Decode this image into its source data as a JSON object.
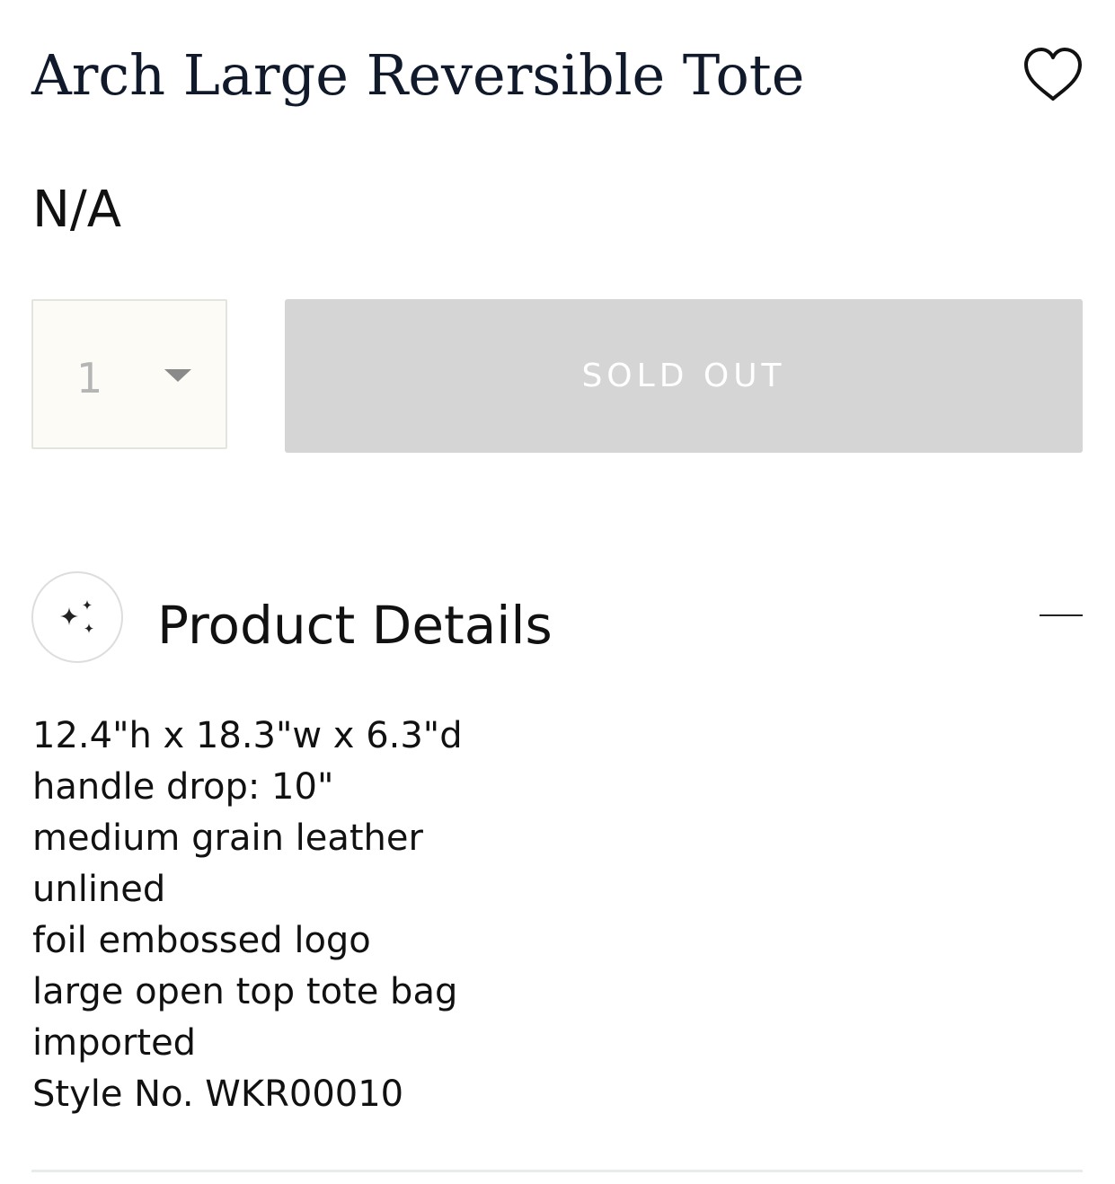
{
  "product": {
    "title": "Arch Large Reversible Tote",
    "price": "N/A"
  },
  "purchase": {
    "quantity": "1",
    "button_label": "SOLD OUT"
  },
  "details": {
    "heading": "Product Details",
    "items": [
      "12.4\"h x 18.3\"w x 6.3\"d",
      "handle drop: 10\"",
      "medium grain leather",
      "unlined",
      "foil embossed logo",
      "large open top tote bag",
      "imported",
      "Style No. WKR00010"
    ]
  },
  "icons": {
    "wishlist": "heart-icon",
    "details": "sparkles-icon",
    "collapse": "minus-icon",
    "quantity_dropdown": "caret-down-icon"
  },
  "colors": {
    "title": "#101a2b",
    "sold_out_bg": "#d5d5d5",
    "quantity_bg": "#fcfbf6"
  }
}
